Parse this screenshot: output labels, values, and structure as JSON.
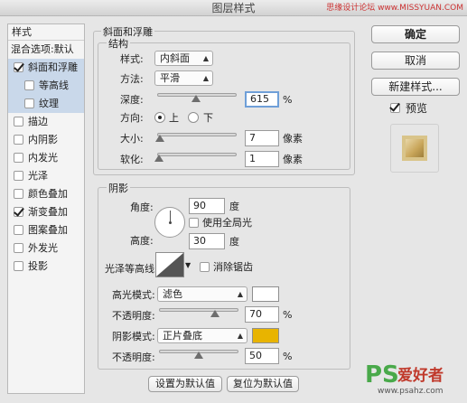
{
  "window": {
    "title": "图层样式",
    "watermark": "思缘设计论坛 www.MISSYUAN.COM"
  },
  "styles": {
    "header": "样式",
    "blend_label": "混合选项:默认",
    "items": [
      {
        "label": "斜面和浮雕",
        "checked": true,
        "selected": true,
        "sub": false
      },
      {
        "label": "等高线",
        "checked": false,
        "selected": true,
        "sub": true
      },
      {
        "label": "纹理",
        "checked": false,
        "selected": true,
        "sub": true
      },
      {
        "label": "描边",
        "checked": false,
        "selected": false,
        "sub": false
      },
      {
        "label": "内阴影",
        "checked": false,
        "selected": false,
        "sub": false
      },
      {
        "label": "内发光",
        "checked": false,
        "selected": false,
        "sub": false
      },
      {
        "label": "光泽",
        "checked": false,
        "selected": false,
        "sub": false
      },
      {
        "label": "颜色叠加",
        "checked": false,
        "selected": false,
        "sub": false
      },
      {
        "label": "渐变叠加",
        "checked": true,
        "selected": false,
        "sub": false
      },
      {
        "label": "图案叠加",
        "checked": false,
        "selected": false,
        "sub": false
      },
      {
        "label": "外发光",
        "checked": false,
        "selected": false,
        "sub": false
      },
      {
        "label": "投影",
        "checked": false,
        "selected": false,
        "sub": false
      }
    ]
  },
  "bevel": {
    "section_title": "斜面和浮雕",
    "structure_title": "结构",
    "style_label": "样式:",
    "style_value": "内斜面",
    "technique_label": "方法:",
    "technique_value": "平滑",
    "depth_label": "深度:",
    "depth_value": "615",
    "depth_unit": "%",
    "depth_slider": 0.49,
    "direction_label": "方向:",
    "direction_up": "上",
    "direction_down": "下",
    "direction_selected": "up",
    "size_label": "大小:",
    "size_value": "7",
    "size_unit": "像素",
    "size_slider": 0.03,
    "soften_label": "软化:",
    "soften_value": "1",
    "soften_unit": "像素",
    "soften_slider": 0.02
  },
  "shading": {
    "title": "阴影",
    "angle_label": "角度:",
    "angle_value": "90",
    "angle_unit": "度",
    "global_light_label": "使用全局光",
    "global_light_checked": false,
    "altitude_label": "高度:",
    "altitude_value": "30",
    "altitude_unit": "度",
    "gloss_contour_label": "光泽等高线:",
    "anti_alias_label": "消除锯齿",
    "anti_alias_checked": false,
    "highlight_mode_label": "高光模式:",
    "highlight_mode_value": "滤色",
    "highlight_color": "#ffffff",
    "highlight_opacity_label": "不透明度:",
    "highlight_opacity_value": "70",
    "highlight_opacity_unit": "%",
    "highlight_opacity_slider": 0.7,
    "shadow_mode_label": "阴影模式:",
    "shadow_mode_value": "正片叠底",
    "shadow_color": "#e8b400",
    "shadow_opacity_label": "不透明度:",
    "shadow_opacity_value": "50",
    "shadow_opacity_unit": "%",
    "shadow_opacity_slider": 0.5
  },
  "footer": {
    "make_default": "设置为默认值",
    "reset_default": "复位为默认值"
  },
  "right": {
    "ok": "确定",
    "cancel": "取消",
    "new_style": "新建样式...",
    "preview_label": "预览",
    "preview_checked": true
  },
  "logo": {
    "ps": "PS",
    "cn": "爱好者",
    "url": "www.psahz.com"
  },
  "colors": {
    "selected_row": "#c9d8ea",
    "focus_ring": "#6f9fd8",
    "preview_gold": "#c9a65a"
  },
  "icons": [
    "checkmark-icon",
    "dropdown-arrow-icon",
    "radio-icon",
    "angle-dial-icon",
    "contour-curve-icon"
  ]
}
